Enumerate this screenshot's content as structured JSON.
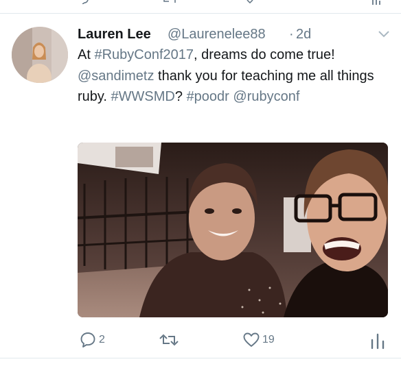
{
  "tweet": {
    "display_name": "Lauren Lee",
    "handle": "@Laurenelee88",
    "separator": "·",
    "time": "2d",
    "text": [
      {
        "t": "At ",
        "link": false
      },
      {
        "t": "#RubyConf2017",
        "link": true
      },
      {
        "t": ", dreams do come true! ",
        "link": false
      },
      {
        "t": "@sandimetz",
        "link": true
      },
      {
        "t": " thank you for teaching me all things ruby. ",
        "link": false
      },
      {
        "t": "#WWSMD",
        "link": true
      },
      {
        "t": "? ",
        "link": false
      },
      {
        "t": "#poodr",
        "link": true
      },
      {
        "t": " ",
        "link": false
      },
      {
        "t": "@rubyconf",
        "link": true
      }
    ],
    "actions": {
      "reply_count": "2",
      "retweet_count": "",
      "like_count": "19"
    }
  },
  "icons": {
    "reply": "reply-icon",
    "retweet": "retweet-icon",
    "like": "heart-icon",
    "analytics": "analytics-icon",
    "menu": "chevron-down-icon"
  },
  "colors": {
    "text": "#14171a",
    "secondary": "#657786",
    "divider": "#e1e8ed"
  }
}
